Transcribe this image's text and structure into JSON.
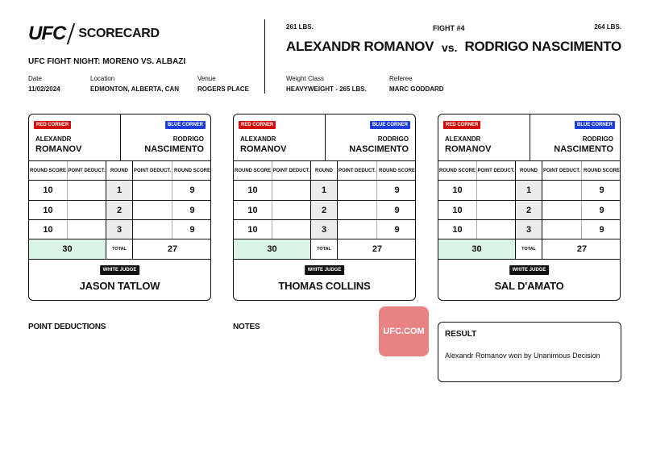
{
  "header": {
    "logo_text": "UFC",
    "doc_title": "SCORECARD",
    "event": "UFC FIGHT NIGHT: MORENO VS. ALBAZI",
    "date_label": "Date",
    "date": "11/02/2024",
    "location_label": "Location",
    "location": "EDMONTON, ALBERTA, CAN",
    "venue_label": "Venue",
    "venue": "ROGERS PLACE"
  },
  "fight": {
    "number": "FIGHT #4",
    "red_weight": "261 LBS.",
    "blue_weight": "264 LBS.",
    "red_name": "ALEXANDR ROMANOV",
    "vs": "vs.",
    "blue_name": "RODRIGO NASCIMENTO",
    "weight_class_label": "Weight Class",
    "weight_class": "HEAVYWEIGHT - 265 LBS.",
    "referee_label": "Referee",
    "referee": "MARC GODDARD"
  },
  "labels": {
    "red_corner": "RED CORNER",
    "blue_corner": "BLUE CORNER",
    "red_first": "ALEXANDR",
    "red_last": "ROMANOV",
    "blue_first": "RODRIGO",
    "blue_last": "NASCIMENTO",
    "round_score": "ROUND SCORE",
    "point_deduct": "POINT DEDUCT.",
    "round": "ROUND",
    "total": "TOTAL",
    "white_judge": "WHITE JUDGE"
  },
  "cards": [
    {
      "judge": "JASON TATLOW",
      "rounds": [
        {
          "red": "10",
          "red_ded": "",
          "round": "1",
          "blue_ded": "",
          "blue": "9"
        },
        {
          "red": "10",
          "red_ded": "",
          "round": "2",
          "blue_ded": "",
          "blue": "9"
        },
        {
          "red": "10",
          "red_ded": "",
          "round": "3",
          "blue_ded": "",
          "blue": "9"
        }
      ],
      "red_total": "30",
      "blue_total": "27"
    },
    {
      "judge": "THOMAS COLLINS",
      "rounds": [
        {
          "red": "10",
          "red_ded": "",
          "round": "1",
          "blue_ded": "",
          "blue": "9"
        },
        {
          "red": "10",
          "red_ded": "",
          "round": "2",
          "blue_ded": "",
          "blue": "9"
        },
        {
          "red": "10",
          "red_ded": "",
          "round": "3",
          "blue_ded": "",
          "blue": "9"
        }
      ],
      "red_total": "30",
      "blue_total": "27"
    },
    {
      "judge": "SAL D'AMATO",
      "rounds": [
        {
          "red": "10",
          "red_ded": "",
          "round": "1",
          "blue_ded": "",
          "blue": "9"
        },
        {
          "red": "10",
          "red_ded": "",
          "round": "2",
          "blue_ded": "",
          "blue": "9"
        },
        {
          "red": "10",
          "red_ded": "",
          "round": "3",
          "blue_ded": "",
          "blue": "9"
        }
      ],
      "red_total": "30",
      "blue_total": "27"
    }
  ],
  "bottom": {
    "point_deductions_title": "POINT DEDUCTIONS",
    "notes_title": "NOTES",
    "stamp": "UFC.COM",
    "result_title": "RESULT",
    "result_text": "Alexandr Romanov won by Unanimous Decision"
  },
  "colors": {
    "red_corner": "#d20a0a",
    "blue_corner": "#1f3fdc",
    "winner_total_bg": "#d9f3e6",
    "stamp": "#e98383"
  }
}
